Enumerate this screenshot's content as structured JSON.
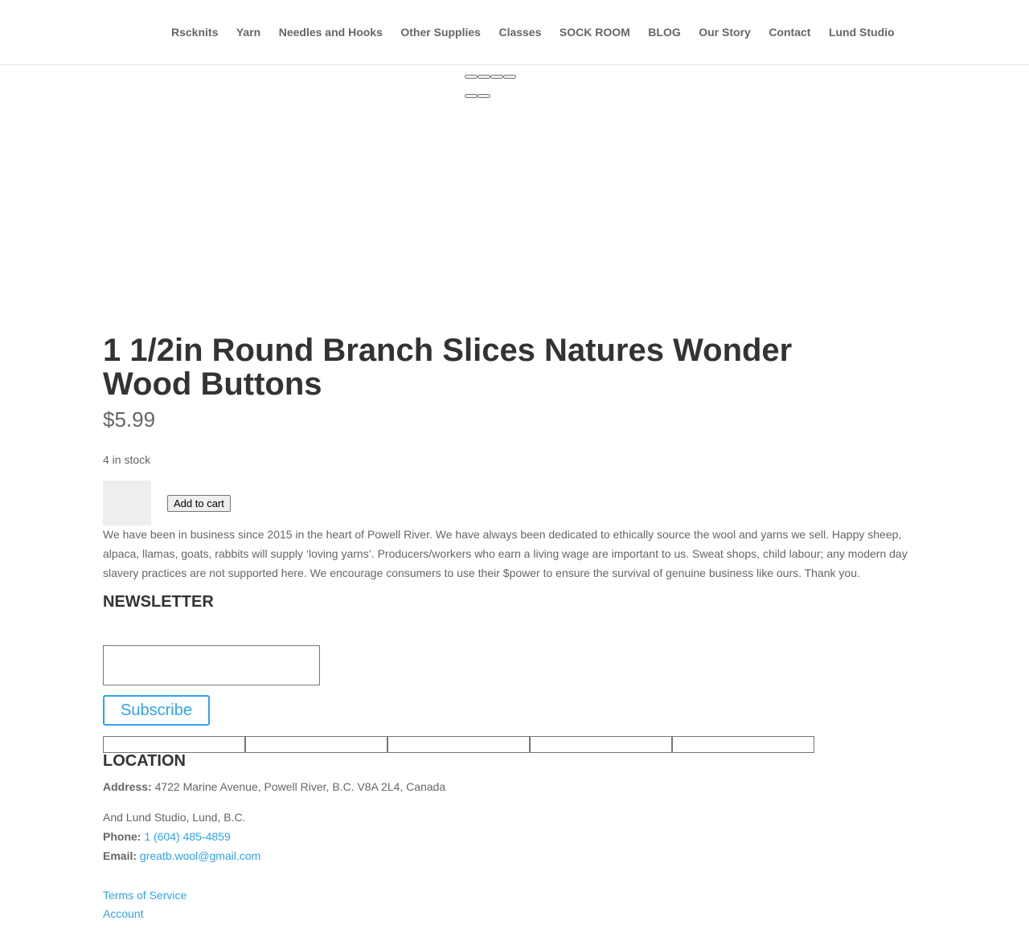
{
  "nav": {
    "items": [
      {
        "label": "Rscknits"
      },
      {
        "label": "Yarn"
      },
      {
        "label": "Needles and Hooks"
      },
      {
        "label": "Other Supplies"
      },
      {
        "label": "Classes"
      },
      {
        "label": "SOCK ROOM"
      },
      {
        "label": "BLOG"
      },
      {
        "label": "Our Story"
      },
      {
        "label": "Contact"
      },
      {
        "label": "Lund Studio"
      }
    ]
  },
  "product": {
    "title": "1 1/2in Round Branch Slices Natures Wonder Wood Buttons",
    "price": "$5.99",
    "stock": "4 in stock",
    "add_to_cart_label": "Add to cart"
  },
  "about": {
    "text": "We have been in business since 2015 in the heart of Powell River. We have always been dedicated to ethically source the wool and yarns we sell.  Happy sheep, alpaca, llamas, goats, rabbits will supply ‘loving yarns’.   Producers/workers who earn a living wage are important to us.  Sweat shops, child labour; any modern day slavery practices are not supported here. We encourage consumers to use their $power to ensure the survival of genuine business like ours.  Thank you."
  },
  "newsletter": {
    "title": "NEWSLETTER",
    "email_value": "",
    "subscribe_label": "Subscribe"
  },
  "location": {
    "title": "LOCATION",
    "address_label": "Address:",
    "address_value": "4722 Marine Avenue, Powell River, B.C. V8A 2L4, Canada",
    "second_location": "And Lund Studio, Lund, B.C.",
    "phone_label": "Phone:",
    "phone_value": "1 (604) 485-4859",
    "email_label": "Email:",
    "email_value": "greatb.wool@gmail.com"
  },
  "footer": {
    "terms_label": "Terms of Service",
    "account_label": "Account"
  },
  "colors": {
    "link": "#2ea3f2",
    "heading": "#333333",
    "body_text": "#666666"
  }
}
